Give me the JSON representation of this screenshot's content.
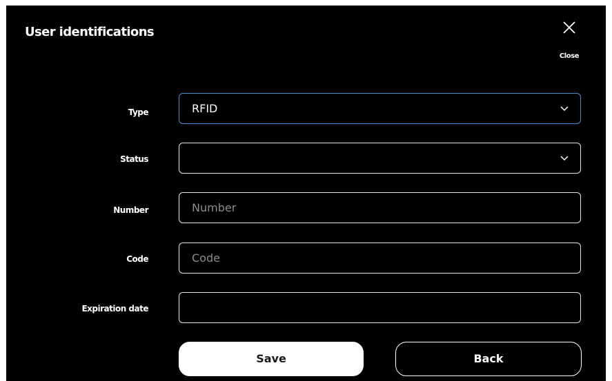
{
  "dialog": {
    "title": "User identifications",
    "close_label": "Close",
    "close_icon": "close-icon"
  },
  "form": {
    "type": {
      "label": "Type",
      "value": "RFID",
      "icon": "chevron-down-icon"
    },
    "status": {
      "label": "Status",
      "value": "",
      "icon": "chevron-down-icon"
    },
    "number": {
      "label": "Number",
      "value": "",
      "placeholder": "Number"
    },
    "code": {
      "label": "Code",
      "value": "",
      "placeholder": "Code"
    },
    "expiration_date": {
      "label": "Expiration date",
      "value": ""
    }
  },
  "actions": {
    "save_label": "Save",
    "back_label": "Back"
  },
  "colors": {
    "background": "#000000",
    "text": "#ffffff",
    "focus_border": "#4a8fd6",
    "placeholder": "#8c8c8c"
  }
}
